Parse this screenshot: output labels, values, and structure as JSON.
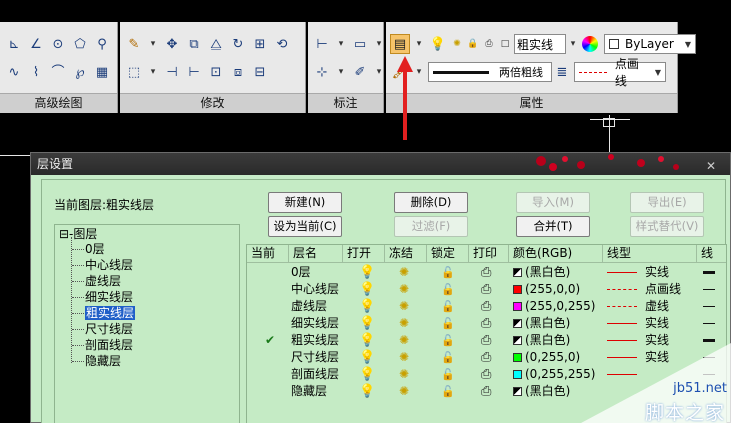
{
  "ribbon": {
    "panels": {
      "draw_advanced": "高级绘图",
      "modify": "修改",
      "annotate": "标注",
      "properties": "属性"
    },
    "layer_combo": "粗实线",
    "color_combo": "ByLayer",
    "linetype_combo": "两倍粗线",
    "lineweight_combo": "点画线"
  },
  "dialog": {
    "title": "层设置",
    "current_layer": "当前图层:粗实线层",
    "buttons": {
      "new": "新建(N)",
      "delete": "删除(D)",
      "import": "导入(M)",
      "export": "导出(E)",
      "set_current": "设为当前(C)",
      "filter": "过滤(F)",
      "merge": "合并(T)",
      "style_replace": "样式替代(V)"
    },
    "tree": {
      "root": "图层",
      "items": [
        "0层",
        "中心线层",
        "虚线层",
        "细实线层",
        "粗实线层",
        "尺寸线层",
        "剖面线层",
        "隐藏层"
      ],
      "selected": "粗实线层"
    },
    "table": {
      "headers": [
        "当前",
        "层名",
        "打开",
        "冻结",
        "锁定",
        "打印",
        "颜色(RGB)",
        "线型",
        "线"
      ],
      "rows": [
        {
          "current": "",
          "name": "0层",
          "on": true,
          "color_text": "(黑白色)",
          "color_hex": "#000000",
          "linetype": "实线",
          "lt_style": "solid",
          "lw": "thick"
        },
        {
          "current": "",
          "name": "中心线层",
          "on": true,
          "color_text": "(255,0,0)",
          "color_hex": "#ff0000",
          "linetype": "点画线",
          "lt_style": "dashdot",
          "lw": "thin"
        },
        {
          "current": "",
          "name": "虚线层",
          "on": true,
          "color_text": "(255,0,255)",
          "color_hex": "#ff00ff",
          "linetype": "虚线",
          "lt_style": "dash",
          "lw": "thin"
        },
        {
          "current": "",
          "name": "细实线层",
          "on": true,
          "color_text": "(黑白色)",
          "color_hex": "#000000",
          "linetype": "实线",
          "lt_style": "solid",
          "lw": "thin"
        },
        {
          "current": "✔",
          "name": "粗实线层",
          "on": true,
          "color_text": "(黑白色)",
          "color_hex": "#000000",
          "linetype": "实线",
          "lt_style": "solid",
          "lw": "thick"
        },
        {
          "current": "",
          "name": "尺寸线层",
          "on": true,
          "color_text": "(0,255,0)",
          "color_hex": "#00ff00",
          "linetype": "实线",
          "lt_style": "solid",
          "lw": "thin"
        },
        {
          "current": "",
          "name": "剖面线层",
          "on": true,
          "color_text": "(0,255,255)",
          "color_hex": "#00ffff",
          "linetype": "",
          "lt_style": "solid",
          "lw": "thin"
        },
        {
          "current": "",
          "name": "隐藏层",
          "on": false,
          "color_text": "(黑白色)",
          "color_hex": "#000000",
          "linetype": "",
          "lt_style": "",
          "lw": "none"
        }
      ]
    }
  },
  "watermark": {
    "url": "jb51.net",
    "text": "脚本之家"
  }
}
